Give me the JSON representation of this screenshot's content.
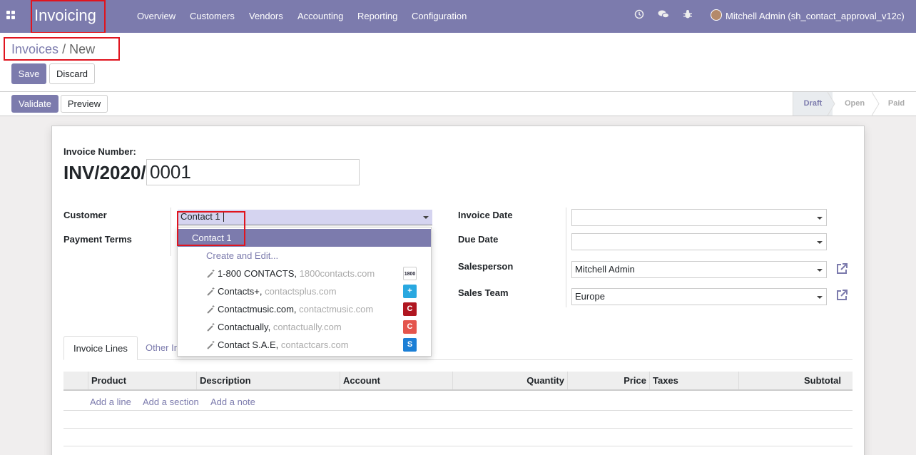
{
  "topbar": {
    "app_title": "Invoicing",
    "menu": [
      "Overview",
      "Customers",
      "Vendors",
      "Accounting",
      "Reporting",
      "Configuration"
    ],
    "user": "Mitchell Admin (sh_contact_approval_v12c)",
    "icons": [
      "apps-icon",
      "clock-icon",
      "chat-icon",
      "bug-icon",
      "avatar"
    ]
  },
  "breadcrumb": {
    "parent": "Invoices",
    "separator": "/",
    "current": "New"
  },
  "buttons": {
    "save": "Save",
    "discard": "Discard",
    "validate": "Validate",
    "preview": "Preview"
  },
  "status_stages": [
    {
      "label": "Draft",
      "active": true
    },
    {
      "label": "Open",
      "active": false
    },
    {
      "label": "Paid",
      "active": false
    }
  ],
  "form": {
    "invoice_number_label": "Invoice Number:",
    "invoice_prefix": "INV/2020/",
    "invoice_number": "0001",
    "customer_label": "Customer",
    "customer_value": "Contact 1",
    "payment_terms_label": "Payment Terms",
    "invoice_date_label": "Invoice Date",
    "invoice_date_value": "",
    "due_date_label": "Due Date",
    "due_date_value": "",
    "salesperson_label": "Salesperson",
    "salesperson_value": "Mitchell Admin",
    "sales_team_label": "Sales Team",
    "sales_team_value": "Europe"
  },
  "tabs": [
    "Invoice Lines",
    "Other Info"
  ],
  "table": {
    "columns": [
      "Product",
      "Description",
      "Account",
      "Quantity",
      "Price",
      "Taxes",
      "Subtotal"
    ],
    "add_links": [
      "Add a line",
      "Add a section",
      "Add a note"
    ]
  },
  "dropdown": {
    "highlighted": "Contact 1",
    "create_edit": "Create and Edit...",
    "suggestions": [
      {
        "name": "1-800 CONTACTS,",
        "domain": "1800contacts.com",
        "logo": "1800"
      },
      {
        "name": "Contacts+,",
        "domain": "contactsplus.com",
        "logo": "+"
      },
      {
        "name": "Contactmusic.com,",
        "domain": "contactmusic.com",
        "logo": "C"
      },
      {
        "name": "Contactually,",
        "domain": "contactually.com",
        "logo": "C"
      },
      {
        "name": "Contact S.A.E,",
        "domain": "contactcars.com",
        "logo": "S"
      }
    ]
  },
  "colors": {
    "brand": "#7c7bad",
    "highlight_box": "#e0141e"
  }
}
